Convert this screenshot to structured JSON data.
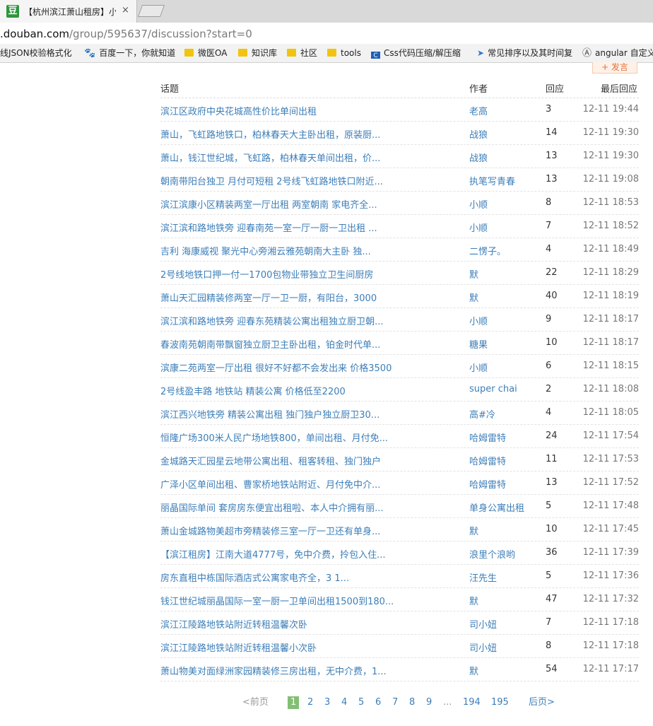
{
  "browser": {
    "tab_title": "【杭州滨江萧山租房】小",
    "tab_close": "×",
    "favicon_text": "豆",
    "url_host": ".douban.com",
    "url_path": "/group/595637/discussion?start=0"
  },
  "bookmarks": [
    {
      "label": "线JSON校验格式化",
      "icon": "none"
    },
    {
      "label": "百度一下，你就知道",
      "icon": "paw-icon"
    },
    {
      "label": "微医OA",
      "icon": "folder-icon"
    },
    {
      "label": "知识库",
      "icon": "folder-icon"
    },
    {
      "label": "社区",
      "icon": "folder-icon"
    },
    {
      "label": "tools",
      "icon": "folder-icon"
    },
    {
      "label": "Css代码压缩/解压缩",
      "icon": "css-icon"
    },
    {
      "label": "常见排序以及其时间复",
      "icon": "plane-icon"
    },
    {
      "label": "angular 自定义",
      "icon": "angular-icon"
    }
  ],
  "post_button": "+ 发言",
  "table": {
    "headers": {
      "title": "话题",
      "author": "作者",
      "count": "回应",
      "time": "最后回应"
    },
    "rows": [
      {
        "title": "滨江区政府中央花城高性价比单间出租",
        "author": "老高",
        "count": "3",
        "time": "12-11 19:44"
      },
      {
        "title": "萧山，飞虹路地铁口，柏林春天大主卧出租，原装厨...",
        "author": "战狼",
        "count": "14",
        "time": "12-11 19:30"
      },
      {
        "title": "萧山，钱江世纪城，飞虹路，柏林春天单间出租，价...",
        "author": "战狼",
        "count": "13",
        "time": "12-11 19:30"
      },
      {
        "title": "朝南带阳台独卫 月付可短租 2号线飞虹路地铁口附近...",
        "author": "执笔写青春",
        "count": "13",
        "time": "12-11 19:08"
      },
      {
        "title": "滨江滨康小区精装两室一厅出租 两室朝南 家电齐全...",
        "author": "小顺",
        "count": "8",
        "time": "12-11 18:53"
      },
      {
        "title": "滨江滨和路地铁旁 迎春南苑一室一厅一厨一卫出租 ...",
        "author": "小顺",
        "count": "7",
        "time": "12-11 18:52"
      },
      {
        "title": "吉利 海康威视 聚光中心旁湘云雅苑朝南大主卧 独...",
        "author": "二愣子。",
        "count": "4",
        "time": "12-11 18:49"
      },
      {
        "title": "2号线地铁口押一付一1700包物业带独立卫生间厨房",
        "author": "默",
        "count": "22",
        "time": "12-11 18:29"
      },
      {
        "title": "萧山天汇园精装修两室一厅一卫一厨，有阳台，3000",
        "author": "默",
        "count": "40",
        "time": "12-11 18:19"
      },
      {
        "title": "滨江滨和路地铁旁 迎春东苑精装公寓出租独立厨卫朝...",
        "author": "小顺",
        "count": "9",
        "time": "12-11 18:17"
      },
      {
        "title": "春波南苑朝南带飘窗独立厨卫主卧出租，铂金时代单...",
        "author": "糖果",
        "count": "10",
        "time": "12-11 18:17"
      },
      {
        "title": "滨康二苑两室一厅出租 很好不好都不会发出来 价格3500",
        "author": "小顺",
        "count": "6",
        "time": "12-11 18:15"
      },
      {
        "title": "2号线盈丰路 地铁站 精装公寓 价格低至2200",
        "author": "super chai",
        "count": "2",
        "time": "12-11 18:08"
      },
      {
        "title": "滨江西兴地铁旁 精装公寓出租 独门独户独立厨卫30...",
        "author": "高#冷",
        "count": "4",
        "time": "12-11 18:05"
      },
      {
        "title": "恒隆广场300米人民广场地铁800，单间出租、月付免...",
        "author": "哈姆雷特",
        "count": "24",
        "time": "12-11 17:54"
      },
      {
        "title": "金城路天汇园星云地带公寓出租、租客转租、独门独户",
        "author": "哈姆雷特",
        "count": "11",
        "time": "12-11 17:53"
      },
      {
        "title": "广泽小区单间出租、曹家桥地铁站附近、月付免中介...",
        "author": "哈姆雷特",
        "count": "13",
        "time": "12-11 17:52"
      },
      {
        "title": "丽晶国际单间 套房房东便宜出租啦、本人中介拥有丽...",
        "author": "单身公寓出租",
        "count": "5",
        "time": "12-11 17:48"
      },
      {
        "title": "萧山金城路物美超市旁精装修三室一厅一卫还有单身...",
        "author": "默",
        "count": "10",
        "time": "12-11 17:45"
      },
      {
        "title": "【滨江租房】江南大道4777号，免中介费，拎包入住...",
        "author": "浪里个浪哟",
        "count": "36",
        "time": "12-11 17:39"
      },
      {
        "title": "房东直租中栋国际酒店式公寓家电齐全，3   1...",
        "author": "汪先生",
        "count": "5",
        "time": "12-11 17:36"
      },
      {
        "title": "钱江世纪城丽晶国际一室一厨一卫单间出租1500到180...",
        "author": "默",
        "count": "47",
        "time": "12-11 17:32"
      },
      {
        "title": "滨江江陵路地铁站附近转租温馨次卧",
        "author": "司小妞",
        "count": "7",
        "time": "12-11 17:18"
      },
      {
        "title": "滨江江陵路地铁站附近转租温馨小次卧",
        "author": "司小妞",
        "count": "8",
        "time": "12-11 17:18"
      },
      {
        "title": "萧山物美对面绿洲家园精装修三房出租，无中介费，1...",
        "author": "默",
        "count": "54",
        "time": "12-11 17:17"
      }
    ]
  },
  "paginator": {
    "prev": "<前页",
    "pages": [
      "1",
      "2",
      "3",
      "4",
      "5",
      "6",
      "7",
      "8",
      "9"
    ],
    "current": "1",
    "ellipsis": "...",
    "tail_pages": [
      "194",
      "195"
    ],
    "next": "后页>"
  }
}
